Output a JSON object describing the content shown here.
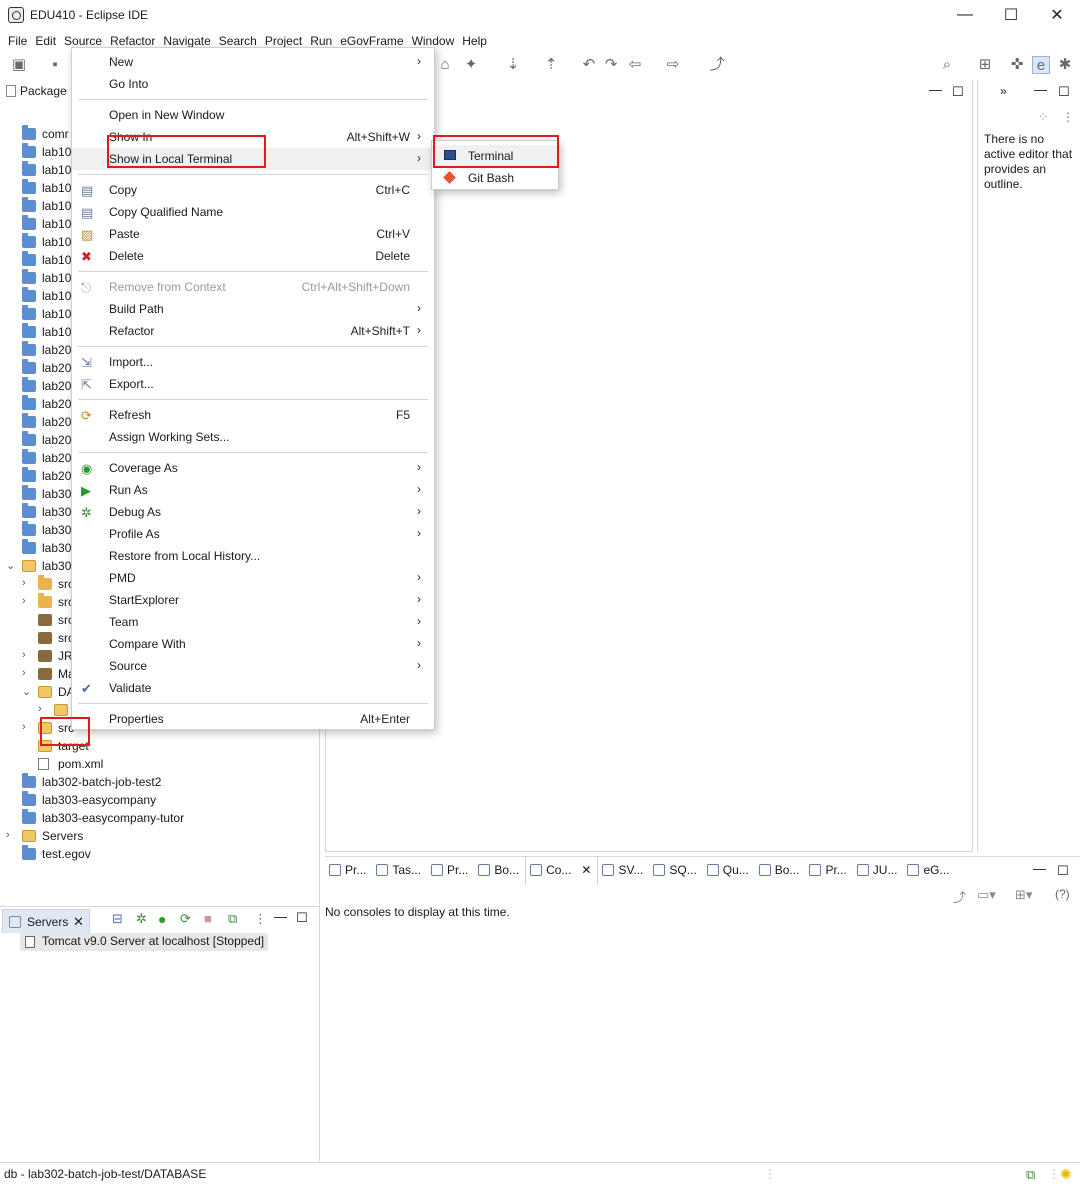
{
  "window": {
    "title": "EDU410 - Eclipse IDE",
    "minimize": "—",
    "maximize": "☐",
    "close": "✕"
  },
  "menubar": [
    "File",
    "Edit",
    "Source",
    "Refactor",
    "Navigate",
    "Search",
    "Project",
    "Run",
    "eGovFrame",
    "Window",
    "Help"
  ],
  "package_explorer": {
    "tab_label": "Package",
    "tree": [
      {
        "label": "comr"
      },
      {
        "label": "lab10"
      },
      {
        "label": "lab10"
      },
      {
        "label": "lab10"
      },
      {
        "label": "lab10"
      },
      {
        "label": "lab10"
      },
      {
        "label": "lab10"
      },
      {
        "label": "lab10"
      },
      {
        "label": "lab10"
      },
      {
        "label": "lab10"
      },
      {
        "label": "lab10"
      },
      {
        "label": "lab10"
      },
      {
        "label": "lab20"
      },
      {
        "label": "lab20"
      },
      {
        "label": "lab20"
      },
      {
        "label": "lab20"
      },
      {
        "label": "lab20"
      },
      {
        "label": "lab20"
      },
      {
        "label": "lab20"
      },
      {
        "label": "lab20"
      },
      {
        "label": "lab30"
      },
      {
        "label": "lab30"
      },
      {
        "label": "lab30"
      },
      {
        "label": "lab30"
      }
    ],
    "expanded_project": "lab30",
    "children": [
      "src",
      "src",
      "src",
      "src",
      "JRI",
      "Ma",
      "DA",
      "db",
      "src",
      "target",
      "pom.xml"
    ],
    "bottom_items": [
      "lab302-batch-job-test2",
      "lab303-easycompany",
      "lab303-easycompany-tutor",
      "Servers",
      "test.egov"
    ]
  },
  "servers": {
    "tab_label": "Servers",
    "row": "Tomcat v9.0 Server at localhost  [Stopped]"
  },
  "outline": {
    "message": "There is no active editor that provides an outline."
  },
  "console": {
    "tabs": [
      "Pr...",
      "Tas...",
      "Pr...",
      "Bo...",
      "Co...",
      "SV...",
      "SQ...",
      "Qu...",
      "Bo...",
      "Pr...",
      "JU...",
      "eG..."
    ],
    "active_tab": "Co...",
    "message": "No consoles to display at this time."
  },
  "status": {
    "text": "db - lab302-batch-job-test/DATABASE"
  },
  "context_menu": {
    "items": [
      {
        "label": "New",
        "submenu": true
      },
      {
        "label": "Go Into"
      },
      {
        "sep": true
      },
      {
        "label": "Open in New Window"
      },
      {
        "label": "Show In",
        "accel": "Alt+Shift+W",
        "submenu": true
      },
      {
        "label": "Show in Local Terminal",
        "submenu": true,
        "highlighted": true
      },
      {
        "sep": true
      },
      {
        "label": "Copy",
        "accel": "Ctrl+C",
        "icon": "copy-icon"
      },
      {
        "label": "Copy Qualified Name",
        "icon": "copy-qualified-icon"
      },
      {
        "label": "Paste",
        "accel": "Ctrl+V",
        "icon": "paste-icon"
      },
      {
        "label": "Delete",
        "accel": "Delete",
        "icon": "delete-icon"
      },
      {
        "sep": true
      },
      {
        "label": "Remove from Context",
        "accel": "Ctrl+Alt+Shift+Down",
        "disabled": true,
        "icon": "remove-context-icon"
      },
      {
        "label": "Build Path",
        "submenu": true
      },
      {
        "label": "Refactor",
        "accel": "Alt+Shift+T",
        "submenu": true
      },
      {
        "sep": true
      },
      {
        "label": "Import...",
        "icon": "import-icon"
      },
      {
        "label": "Export...",
        "icon": "export-icon"
      },
      {
        "sep": true
      },
      {
        "label": "Refresh",
        "accel": "F5",
        "icon": "refresh-icon"
      },
      {
        "label": "Assign Working Sets..."
      },
      {
        "sep": true
      },
      {
        "label": "Coverage As",
        "submenu": true,
        "icon": "coverage-icon"
      },
      {
        "label": "Run As",
        "submenu": true,
        "icon": "run-icon"
      },
      {
        "label": "Debug As",
        "submenu": true,
        "icon": "debug-icon"
      },
      {
        "label": "Profile As",
        "submenu": true
      },
      {
        "label": "Restore from Local History..."
      },
      {
        "label": "PMD",
        "submenu": true
      },
      {
        "label": "StartExplorer",
        "submenu": true
      },
      {
        "label": "Team",
        "submenu": true
      },
      {
        "label": "Compare With",
        "submenu": true
      },
      {
        "label": "Source",
        "submenu": true
      },
      {
        "label": "Validate",
        "icon": "check-icon"
      },
      {
        "sep": true
      },
      {
        "label": "Properties",
        "accel": "Alt+Enter"
      }
    ]
  },
  "submenu": {
    "items": [
      {
        "label": "Terminal",
        "icon": "terminal-icon",
        "highlighted": true
      },
      {
        "label": "Git Bash",
        "icon": "git-icon"
      }
    ]
  }
}
